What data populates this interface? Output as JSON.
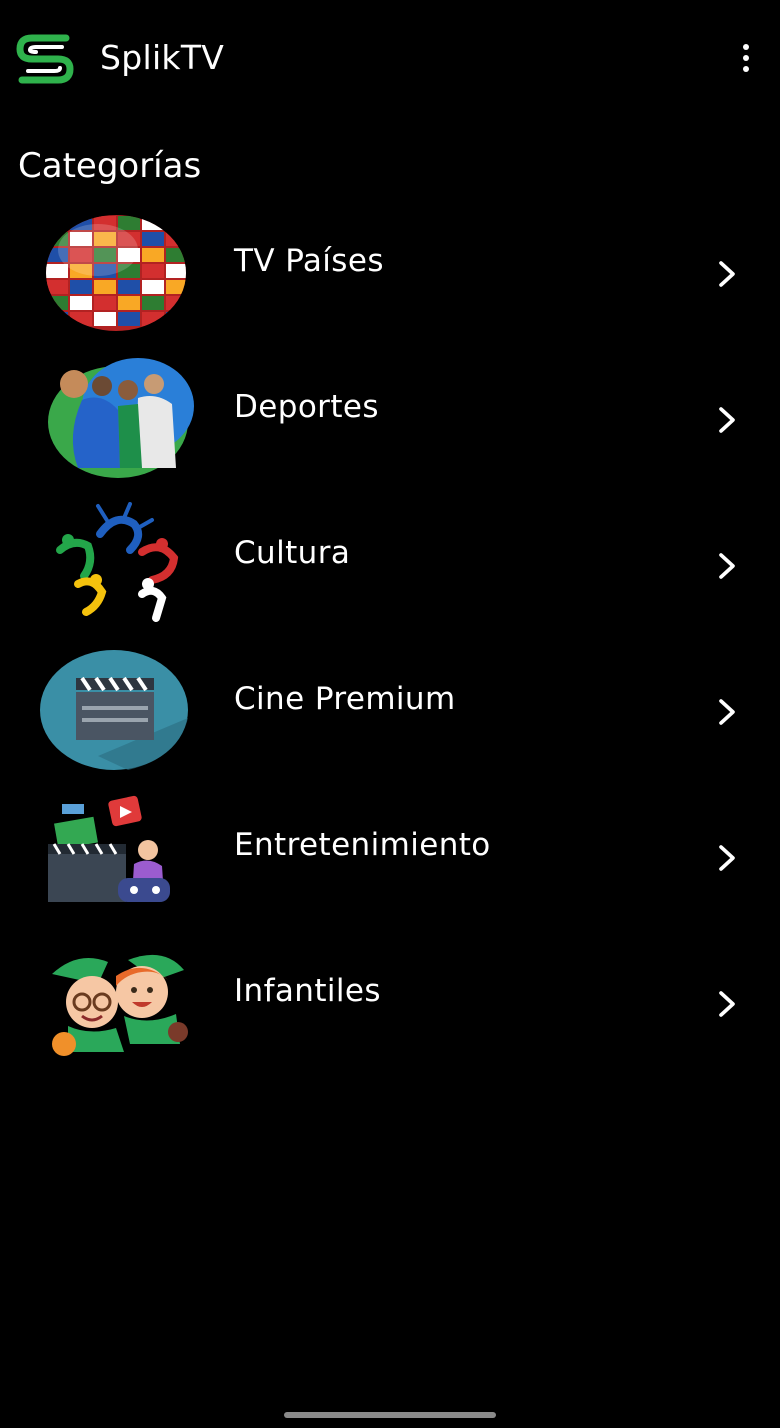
{
  "app": {
    "title": "SplikTV",
    "logo_icon": "splik-s-logo-icon",
    "brand_color": "#2fb24c",
    "menu_icon": "more-vert-icon"
  },
  "section": {
    "title": "Categorías"
  },
  "categories": [
    {
      "label": "TV Países",
      "image": "world-flags-globe",
      "icon": "chevron-right-icon"
    },
    {
      "label": "Deportes",
      "image": "athletes-sports",
      "icon": "chevron-right-icon"
    },
    {
      "label": "Cultura",
      "image": "dancing-figures-culture",
      "icon": "chevron-right-icon"
    },
    {
      "label": "Cine Premium",
      "image": "clapperboard-cinema",
      "icon": "chevron-right-icon"
    },
    {
      "label": "Entretenimiento",
      "image": "entertainment-media",
      "icon": "chevron-right-icon"
    },
    {
      "label": "Infantiles",
      "image": "cartoon-kids",
      "icon": "chevron-right-icon"
    }
  ]
}
